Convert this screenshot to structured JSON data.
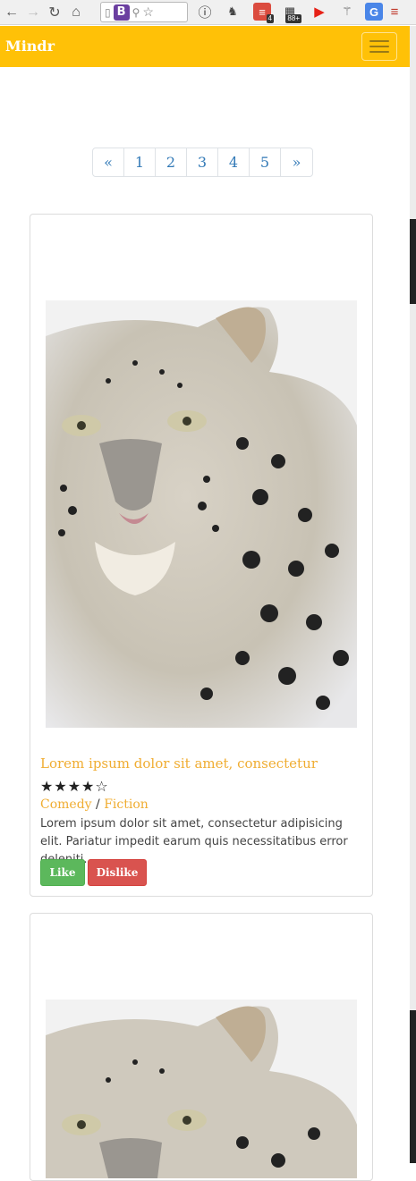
{
  "app": {
    "brand": "Mindr"
  },
  "colors": {
    "navbar": "#ffc107",
    "accent": "#f0ad32",
    "like": "#5cb85c",
    "dislike": "#d9534f",
    "link": "#337ab7"
  },
  "browser": {
    "icons": [
      "back-icon",
      "forward-icon",
      "reload-icon",
      "home-icon",
      "page-icon",
      "bookmark-b-icon",
      "zoom-icon",
      "star-icon"
    ],
    "extensions": [
      {
        "name": "info-icon",
        "badge": ""
      },
      {
        "name": "evernote-icon",
        "badge": ""
      },
      {
        "name": "todoist-icon",
        "badge": "4"
      },
      {
        "name": "counter-icon",
        "badge": "88+"
      },
      {
        "name": "youtube-icon",
        "badge": ""
      },
      {
        "name": "antenna-icon",
        "badge": ""
      },
      {
        "name": "translate-icon",
        "badge": ""
      },
      {
        "name": "menu-icon",
        "badge": ""
      }
    ]
  },
  "pagination": {
    "prev": "«",
    "pages": [
      "1",
      "2",
      "3",
      "4",
      "5"
    ],
    "next": "»"
  },
  "cards": [
    {
      "image": "snow-leopard-image",
      "title": "Lorem ipsum dolor sit amet, consectetur",
      "rating": 4,
      "stars": "★★★★☆",
      "genres": [
        "Comedy",
        "Fiction"
      ],
      "genre_separator": " / ",
      "description": "Lorem ipsum dolor sit amet, consectetur adipisicing elit. Pariatur impedit earum quis necessitatibus error deleniti.",
      "like_label": "Like",
      "dislike_label": "Dislike"
    },
    {
      "image": "snow-leopard-image"
    }
  ]
}
